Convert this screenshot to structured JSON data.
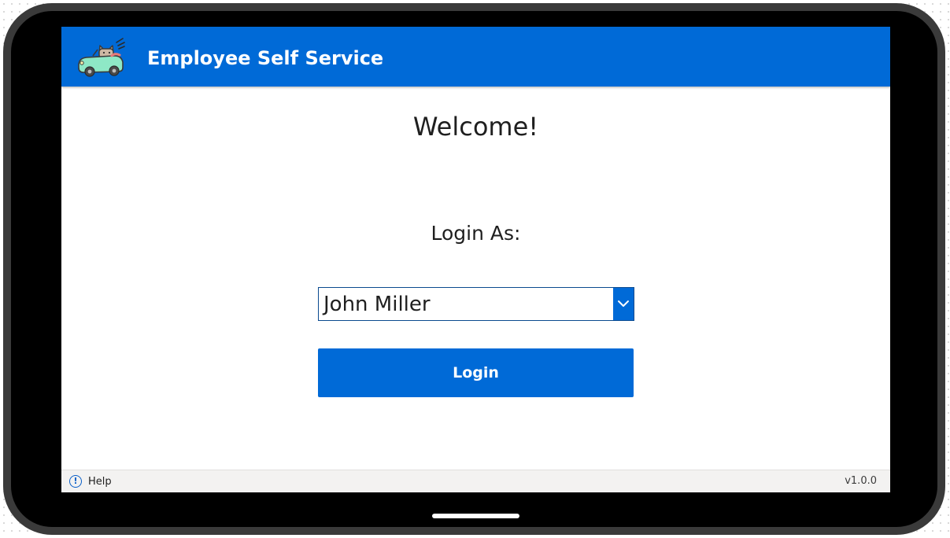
{
  "header": {
    "app_title": "Employee Self Service",
    "logo_icon": "cat-driving-car-logo",
    "background_color": "#006ad7"
  },
  "main": {
    "welcome_text": "Welcome!",
    "login_as_label": "Login As:",
    "user_select": {
      "selected_value": "John Miller",
      "arrow_icon": "chevron-down-icon"
    },
    "login_button_label": "Login",
    "accent_color": "#006ad7"
  },
  "footer": {
    "help_icon": "info-circle-icon",
    "help_label": "Help",
    "version": "v1.0.0"
  }
}
